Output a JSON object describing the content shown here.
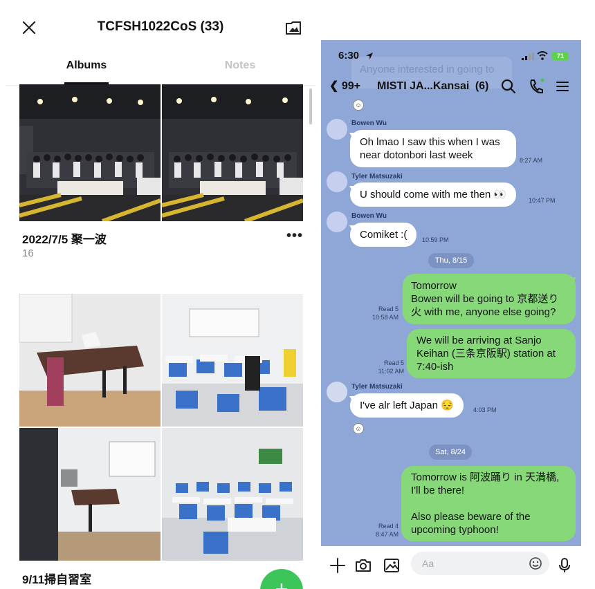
{
  "album_panel": {
    "title": "TCFSH1022CoS (33)",
    "close_icon": "close-icon",
    "album_icon": "album-icon",
    "tabs": [
      {
        "label": "Albums",
        "active": true
      },
      {
        "label": "Notes",
        "active": false
      }
    ],
    "albums": [
      {
        "title": "2022/7/5 聚一波",
        "count": "16"
      },
      {
        "title": "9/11掃自習室",
        "count": ""
      }
    ],
    "fab_label": "+"
  },
  "chat_panel": {
    "status": {
      "time": "6:30",
      "battery": "71"
    },
    "ghost_text": "Anyone interested in going to",
    "header": {
      "back": "99+",
      "title": "MISTI JA...Kansai",
      "member_count": "(6)"
    },
    "messages": [
      {
        "sender": "Bowen Wu",
        "text": "Oh lmao I saw this when I was near dotonbori last week",
        "time": "8:27 AM"
      },
      {
        "sender": "Tyler Matsuzaki",
        "text": "U should come with me then 👀",
        "time": "10:47 PM"
      },
      {
        "sender": "Bowen Wu",
        "text": "Comiket :(",
        "time": "10:59 PM"
      },
      {
        "date": "Thu, 8/15"
      },
      {
        "mine": true,
        "read": "Read 5",
        "time": "10:58 AM",
        "lines": [
          "Tomorrow",
          "Bowen will be going to 京都送り",
          "火 with me, anyone else going?"
        ]
      },
      {
        "mine": true,
        "read": "Read 5",
        "time": "11:02 AM",
        "lines": [
          "We will be arriving at Sanjo",
          "Keihan (三条京阪駅) station at",
          "7:40-ish"
        ]
      },
      {
        "sender": "Tyler Matsuzaki",
        "text": "I've alr left Japan 😔",
        "time": "4:03 PM"
      },
      {
        "date": "Sat, 8/24"
      },
      {
        "mine": true,
        "read": "Read 4",
        "time": "8:47 AM",
        "lines": [
          "Tomorrow is 阿波踊り in 天満橋,",
          "I'll be there!",
          "",
          "Also please beware of the",
          "upcoming typhoon!"
        ]
      }
    ],
    "input": {
      "placeholder": "Aa"
    },
    "colors": {
      "chat_bg": "#8fa7d6",
      "bubble_out": "#86d879",
      "bubble_in": "#ffffff",
      "fab": "#3cc65a"
    }
  }
}
